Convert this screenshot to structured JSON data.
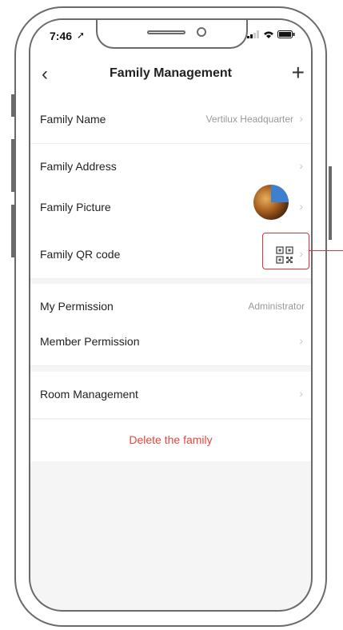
{
  "status_bar": {
    "time": "7:46"
  },
  "navbar": {
    "title": "Family Management",
    "back_glyph": "‹",
    "add_glyph": "+"
  },
  "rows": [
    {
      "label": "Family Name",
      "value": "Vertilux Headquarter"
    },
    {
      "label": "Family Address",
      "value": ""
    },
    {
      "label": "Family Picture",
      "value": ""
    },
    {
      "label": "Family QR code",
      "value": ""
    },
    {
      "label": "My Permission",
      "value": "Administrator"
    },
    {
      "label": "Member Permission",
      "value": ""
    },
    {
      "label": "Room Management",
      "value": ""
    }
  ],
  "delete_label": "Delete the family",
  "colors": {
    "danger": "#e8453c",
    "highlight": "#d9343a",
    "background": "#f5f5f5"
  },
  "icons": {
    "back": "chevron-left-icon",
    "add": "plus-icon",
    "qr": "qr-code-icon",
    "chevron": "chevron-right-icon"
  }
}
